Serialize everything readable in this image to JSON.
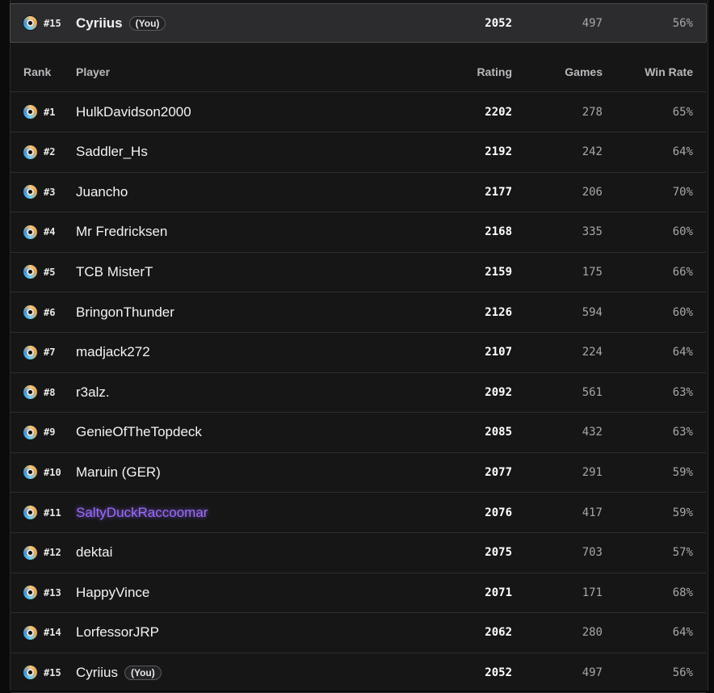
{
  "pinned_row": {
    "rank": "#15",
    "player": "Cyriius",
    "badge": "(You)",
    "rating": "2052",
    "games": "497",
    "win_rate": "56%"
  },
  "headers": {
    "rank": "Rank",
    "player": "Player",
    "rating": "Rating",
    "games": "Games",
    "win_rate": "Win Rate"
  },
  "rows": [
    {
      "rank": "#1",
      "player": "HulkDavidson2000",
      "rating": "2202",
      "games": "278",
      "win_rate": "65%"
    },
    {
      "rank": "#2",
      "player": "Saddler_Hs",
      "rating": "2192",
      "games": "242",
      "win_rate": "64%"
    },
    {
      "rank": "#3",
      "player": "Juancho",
      "rating": "2177",
      "games": "206",
      "win_rate": "70%"
    },
    {
      "rank": "#4",
      "player": "Mr Fredricksen",
      "rating": "2168",
      "games": "335",
      "win_rate": "60%"
    },
    {
      "rank": "#5",
      "player": "TCB MisterT",
      "rating": "2159",
      "games": "175",
      "win_rate": "66%"
    },
    {
      "rank": "#6",
      "player": "BringonThunder",
      "rating": "2126",
      "games": "594",
      "win_rate": "60%"
    },
    {
      "rank": "#7",
      "player": "madjack272",
      "rating": "2107",
      "games": "224",
      "win_rate": "64%"
    },
    {
      "rank": "#8",
      "player": "r3alz.",
      "rating": "2092",
      "games": "561",
      "win_rate": "63%"
    },
    {
      "rank": "#9",
      "player": "GenieOfTheTopdeck",
      "rating": "2085",
      "games": "432",
      "win_rate": "63%"
    },
    {
      "rank": "#10",
      "player": "Maruin (GER)",
      "rating": "2077",
      "games": "291",
      "win_rate": "59%"
    },
    {
      "rank": "#11",
      "player": "SaltyDuckRaccoomar",
      "rating": "2076",
      "games": "417",
      "win_rate": "59%"
    },
    {
      "rank": "#12",
      "player": "dektai",
      "rating": "2075",
      "games": "703",
      "win_rate": "57%"
    },
    {
      "rank": "#13",
      "player": "HappyVince",
      "rating": "2071",
      "games": "171",
      "win_rate": "68%"
    },
    {
      "rank": "#14",
      "player": "LorfessorJRP",
      "rating": "2062",
      "games": "280",
      "win_rate": "64%"
    },
    {
      "rank": "#15",
      "player": "Cyriius",
      "badge": "(You)",
      "rating": "2052",
      "games": "497",
      "win_rate": "56%"
    }
  ],
  "highlight_color": "#9b6bff",
  "rank_icon": "rank-medal-icon"
}
